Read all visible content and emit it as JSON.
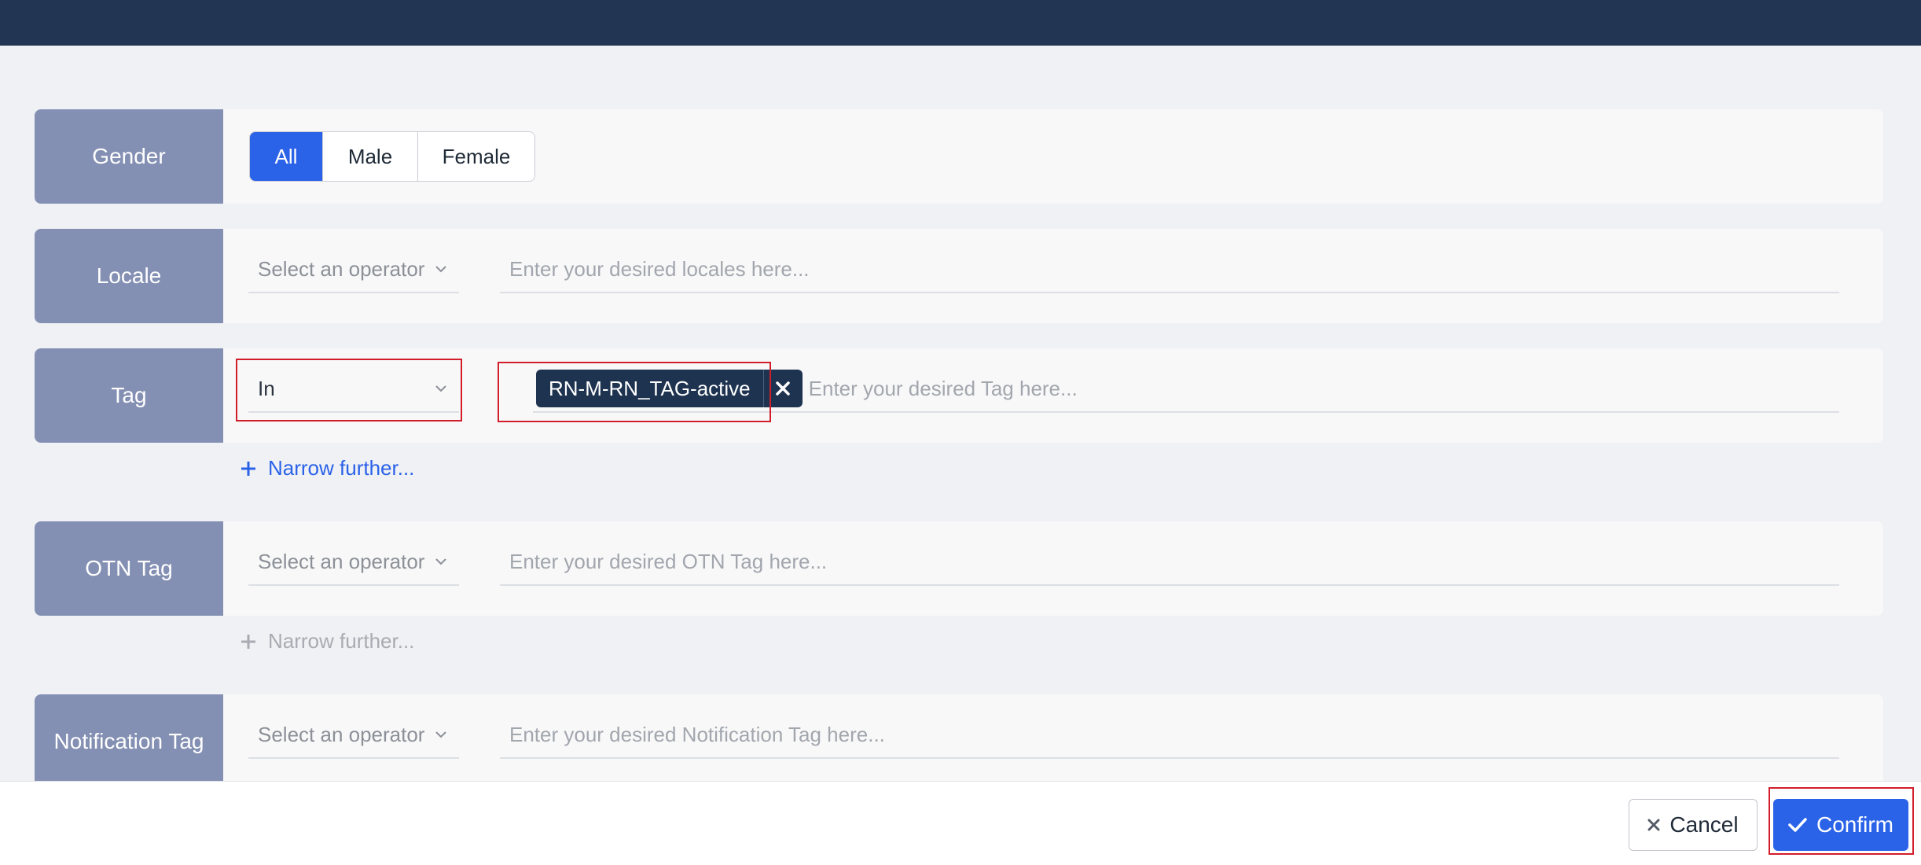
{
  "gender": {
    "label": "Gender",
    "options": [
      "All",
      "Male",
      "Female"
    ],
    "selected": "All"
  },
  "locale": {
    "label": "Locale",
    "operator_placeholder": "Select an operator",
    "input_placeholder": "Enter your desired locales here..."
  },
  "tag": {
    "label": "Tag",
    "operator_value": "In",
    "chip": "RN-M-RN_TAG-active",
    "input_placeholder": "Enter your desired Tag here...",
    "narrow_label": "Narrow further..."
  },
  "otn_tag": {
    "label": "OTN Tag",
    "operator_placeholder": "Select an operator",
    "input_placeholder": "Enter your desired OTN Tag here...",
    "narrow_label": "Narrow further..."
  },
  "notification_tag": {
    "label": "Notification Tag",
    "operator_placeholder": "Select an operator",
    "input_placeholder": "Enter your desired Notification Tag here..."
  },
  "footer": {
    "cancel_label": "Cancel",
    "confirm_label": "Confirm"
  },
  "colors": {
    "topbar": "#223653",
    "accent": "#2a62e8",
    "label_bg": "#8490b3",
    "highlight": "#d21d2a"
  }
}
